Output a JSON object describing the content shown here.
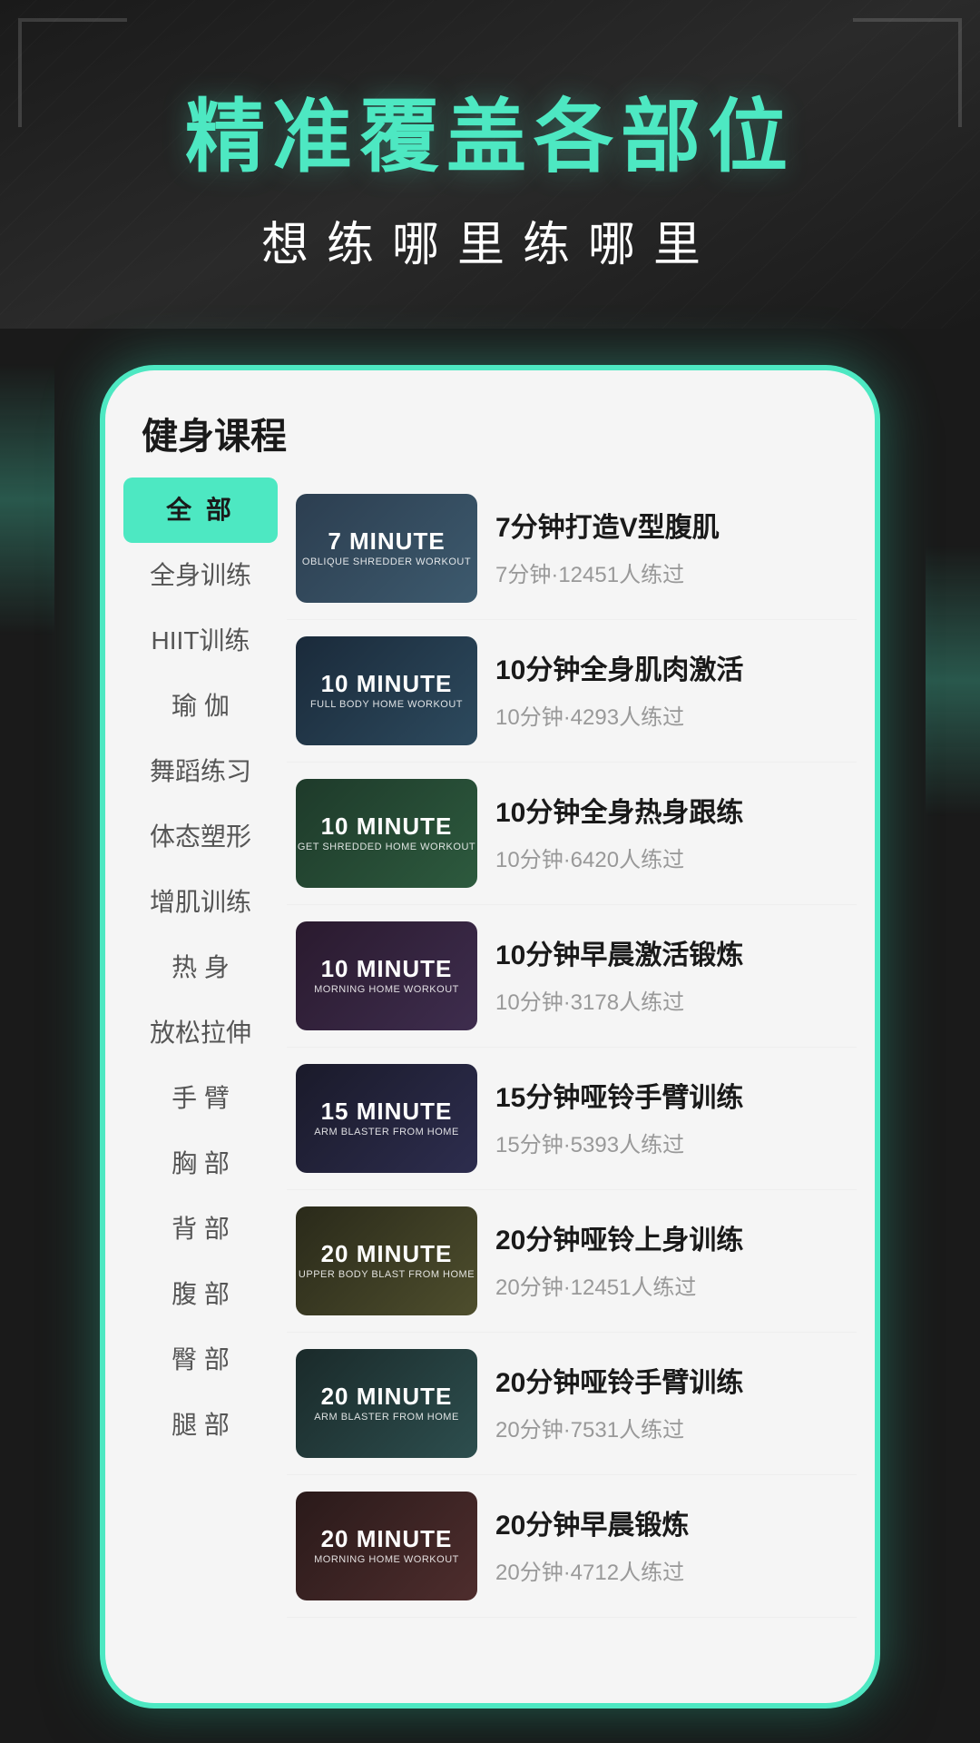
{
  "hero": {
    "title_main": "精准覆盖各部位",
    "title_sub": "想练哪里练哪里"
  },
  "app": {
    "section_title": "健身课程"
  },
  "sidebar": {
    "items": [
      {
        "label": "全  部",
        "active": true
      },
      {
        "label": "全身训练",
        "active": false
      },
      {
        "label": "HIIT训练",
        "active": false
      },
      {
        "label": "瑜  伽",
        "active": false
      },
      {
        "label": "舞蹈练习",
        "active": false
      },
      {
        "label": "体态塑形",
        "active": false
      },
      {
        "label": "增肌训练",
        "active": false
      },
      {
        "label": "热  身",
        "active": false
      },
      {
        "label": "放松拉伸",
        "active": false
      },
      {
        "label": "手  臂",
        "active": false
      },
      {
        "label": "胸  部",
        "active": false
      },
      {
        "label": "背  部",
        "active": false
      },
      {
        "label": "腹  部",
        "active": false
      },
      {
        "label": "臀  部",
        "active": false
      },
      {
        "label": "腿  部",
        "active": false
      }
    ]
  },
  "courses": [
    {
      "id": 1,
      "thumb_minutes": "7 MINUTE",
      "thumb_desc": "OBLIQUE SHREDDER WORKOUT",
      "thumb_class": "thumb-1",
      "name": "7分钟打造V型腹肌",
      "duration": "7分钟",
      "count": "12451人练过"
    },
    {
      "id": 2,
      "thumb_minutes": "10 MINUTE",
      "thumb_desc": "FULL BODY HOME WORKOUT",
      "thumb_class": "thumb-2",
      "name": "10分钟全身肌肉激活",
      "duration": "10分钟",
      "count": "4293人练过"
    },
    {
      "id": 3,
      "thumb_minutes": "10 MINUTE",
      "thumb_desc": "GET SHREDDED HOME WORKOUT",
      "thumb_class": "thumb-3",
      "name": "10分钟全身热身跟练",
      "duration": "10分钟",
      "count": "6420人练过"
    },
    {
      "id": 4,
      "thumb_minutes": "10 MINUTE",
      "thumb_desc": "MORNING HOME WORKOUT",
      "thumb_class": "thumb-4",
      "name": "10分钟早晨激活锻炼",
      "duration": "10分钟",
      "count": "3178人练过"
    },
    {
      "id": 5,
      "thumb_minutes": "15 MINUTE",
      "thumb_desc": "ARM BLASTER FROM HOME",
      "thumb_class": "thumb-5",
      "name": "15分钟哑铃手臂训练",
      "duration": "15分钟",
      "count": "5393人练过"
    },
    {
      "id": 6,
      "thumb_minutes": "20 MINUTE",
      "thumb_desc": "UPPER BODY BLAST FROM HOME",
      "thumb_class": "thumb-6",
      "name": "20分钟哑铃上身训练",
      "duration": "20分钟",
      "count": "12451人练过"
    },
    {
      "id": 7,
      "thumb_minutes": "20 MINUTE",
      "thumb_desc": "ARM BLASTER FROM HOME",
      "thumb_class": "thumb-7",
      "name": "20分钟哑铃手臂训练",
      "duration": "20分钟",
      "count": "7531人练过"
    },
    {
      "id": 8,
      "thumb_minutes": "20 MINUTE",
      "thumb_desc": "MORNING HOME WORKOUT",
      "thumb_class": "thumb-8",
      "name": "20分钟早晨锻炼",
      "duration": "20分钟",
      "count": "4712人练过"
    }
  ]
}
